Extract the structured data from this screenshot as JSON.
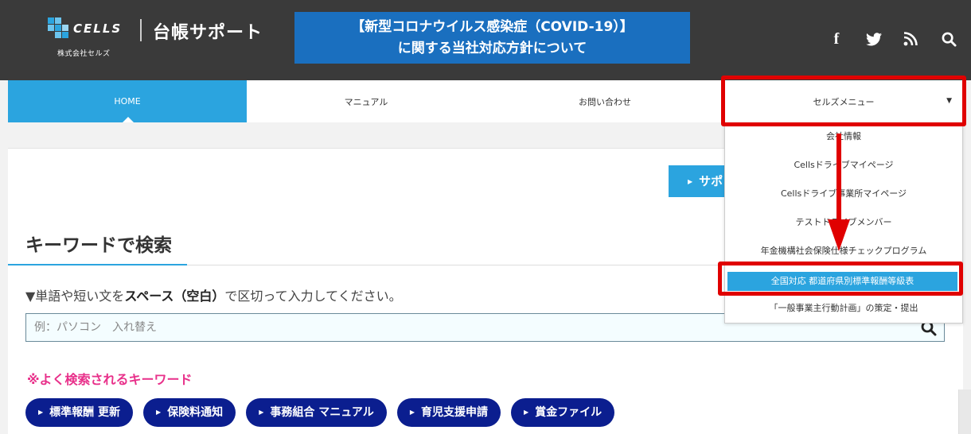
{
  "header": {
    "logo_text": "CELLS",
    "service_name": "台帳サポート",
    "company_name": "株式会社セルズ",
    "banner_line1": "【新型コロナウイルス感染症（COVID-19）】",
    "banner_line2": "に関する当社対応方針について",
    "social_icons": [
      "facebook-icon",
      "twitter-icon",
      "rss-icon",
      "search-icon"
    ]
  },
  "nav": {
    "items": [
      {
        "label": "HOME",
        "active": true
      },
      {
        "label": "マニュアル"
      },
      {
        "label": "お問い合わせ"
      },
      {
        "label": "セルズメニュー",
        "has_dropdown": true
      }
    ],
    "caret": "▼"
  },
  "dropdown": {
    "items": [
      {
        "label": "会社情報"
      },
      {
        "label": "Cellsドライブマイページ"
      },
      {
        "label": "Cellsドライブ事業所マイページ"
      },
      {
        "label": "テストドライブメンバー"
      },
      {
        "label": "年金機構社会保険仕様チェックプログラム"
      },
      {
        "label": "全国対応 都道府県別標準報酬等級表",
        "highlighted": true
      },
      {
        "label": "「一般事業主行動計画」の策定・提出"
      }
    ]
  },
  "main": {
    "support_button_label": "サポ",
    "keyword_title": "キーワードで検索",
    "instruction_prefix": "▼単語や短い文を",
    "instruction_bold": "スペース（空白）",
    "instruction_suffix": "で区切って入力してください。",
    "search_placeholder": "例：パソコン　入れ替え",
    "popular_title": "※よく検索されるキーワード",
    "tags": [
      "標準報酬 更新",
      "保険料通知",
      "事務組合 マニュアル",
      "育児支援申請",
      "賞金ファイル"
    ]
  },
  "colors": {
    "header_bg": "#3a3a3a",
    "banner_bg": "#1a6fbf",
    "accent_blue": "#2ba4df",
    "tag_bg": "#0b1e8f",
    "popular_pink": "#e8308a",
    "annotation_red": "#e00000"
  }
}
